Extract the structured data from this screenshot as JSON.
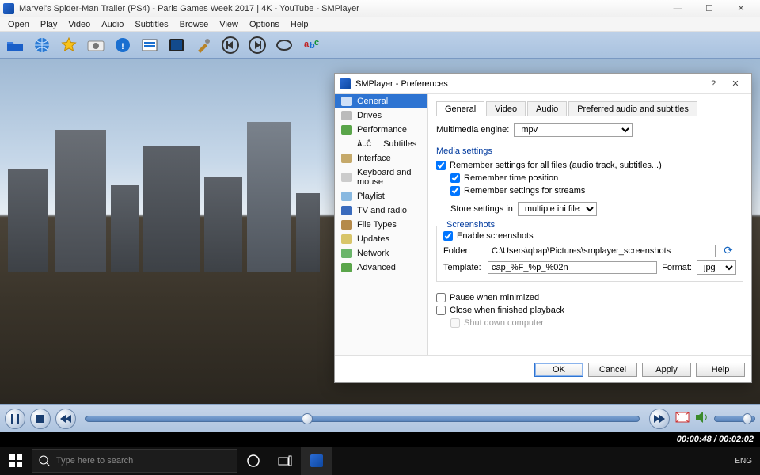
{
  "window": {
    "title": "Marvel's Spider-Man Trailer (PS4) - Paris Games Week 2017 | 4K - YouTube - SMPlayer"
  },
  "menu": [
    "Open",
    "Play",
    "Video",
    "Audio",
    "Subtitles",
    "Browse",
    "View",
    "Options",
    "Help"
  ],
  "status": {
    "time": "00:00:48 / 00:02:02"
  },
  "taskbar": {
    "search_placeholder": "Type here to search",
    "lang": "ENG"
  },
  "dialog": {
    "title": "SMPlayer - Preferences",
    "sidebar": [
      "General",
      "Drives",
      "Performance",
      "Subtitles",
      "Interface",
      "Keyboard and mouse",
      "Playlist",
      "TV and radio",
      "File Types",
      "Updates",
      "Network",
      "Advanced"
    ],
    "sidebar_special": "À..Ĉ",
    "tabs": [
      "General",
      "Video",
      "Audio",
      "Preferred audio and subtitles"
    ],
    "engine_label": "Multimedia engine:",
    "engine_value": "mpv",
    "media_settings_title": "Media settings",
    "chk_remember_all": "Remember settings for all files (audio track, subtitles...)",
    "chk_remember_time": "Remember time position",
    "chk_remember_streams": "Remember settings for streams",
    "store_label": "Store settings in",
    "store_value": "multiple ini files",
    "screenshots_title": "Screenshots",
    "chk_enable_screens": "Enable screenshots",
    "folder_label": "Folder:",
    "folder_value": "C:\\Users\\qbap\\Pictures\\smplayer_screenshots",
    "template_label": "Template:",
    "template_value": "cap_%F_%p_%02n",
    "format_label": "Format:",
    "format_value": "jpg",
    "chk_pause_min": "Pause when minimized",
    "chk_close_finish": "Close when finished playback",
    "chk_shutdown": "Shut down computer",
    "buttons": {
      "ok": "OK",
      "cancel": "Cancel",
      "apply": "Apply",
      "help": "Help"
    }
  }
}
